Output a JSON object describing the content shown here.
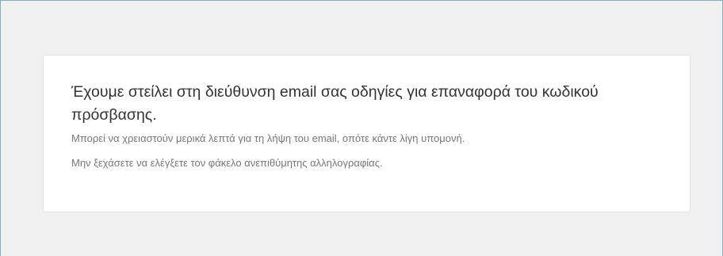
{
  "confirmation": {
    "message": "Έχουμε στείλει στη διεύθυνση email σας οδηγίες για επαναφορά του κωδικού πρόσβασης.",
    "note_wait": "Μπορεί να χρειαστούν μερικά λεπτά για τη λήψη του email, οπότε κάντε λίγη υπομονή.",
    "note_spam": "Μην ξεχάσετε να ελέγξετε τον φάκελο ανεπιθύμητης αλληλογραφίας."
  }
}
